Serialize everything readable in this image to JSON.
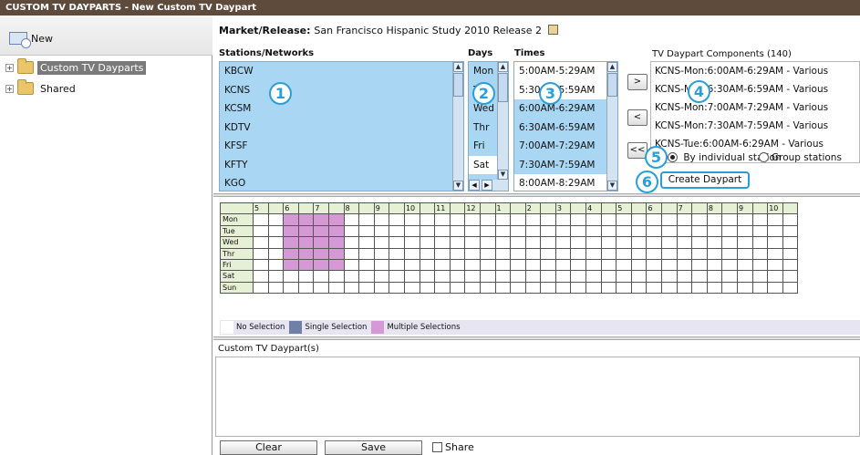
{
  "window": {
    "title": "CUSTOM TV DAYPARTS - New Custom TV Daypart"
  },
  "left_panel": {
    "new_label": "New",
    "tree": [
      {
        "label": "Custom TV Dayparts",
        "selected": true
      },
      {
        "label": "Shared",
        "selected": false
      }
    ]
  },
  "market": {
    "label": "Market/Release:",
    "value": "San Francisco Hispanic Study 2010 Release 2"
  },
  "stations": {
    "header": "Stations/Networks",
    "items": [
      "KBCW",
      "KCNS",
      "KCSM",
      "KDTV",
      "KFSF",
      "KFTY",
      "KGO"
    ]
  },
  "days": {
    "header": "Days",
    "items": [
      "Mon",
      "Tue",
      "Wed",
      "Thr",
      "Fri",
      "Sat"
    ],
    "selected": [
      "Mon",
      "Tue",
      "Wed",
      "Thr",
      "Fri"
    ]
  },
  "times": {
    "header": "Times",
    "items": [
      "5:00AM-5:29AM",
      "5:30AM-5:59AM",
      "6:00AM-6:29AM",
      "6:30AM-6:59AM",
      "7:00AM-7:29AM",
      "7:30AM-7:59AM",
      "8:00AM-8:29AM"
    ],
    "selected": [
      "6:00AM-6:29AM",
      "6:30AM-6:59AM",
      "7:00AM-7:29AM",
      "7:30AM-7:59AM"
    ]
  },
  "transfer_buttons": {
    "add": ">",
    "remove": "<",
    "remove_all": "<<"
  },
  "components": {
    "header": "TV Daypart Components (140)",
    "items": [
      "KCNS-Mon:6:00AM-6:29AM - Various",
      "KCNS-Mon:6:30AM-6:59AM - Various",
      "KCNS-Mon:7:00AM-7:29AM - Various",
      "KCNS-Mon:7:30AM-7:59AM - Various",
      "KCNS-Tue:6:00AM-6:29AM - Various"
    ]
  },
  "options": {
    "by_station": "By individual station",
    "group_stations": "Group stations",
    "selected": "by_station"
  },
  "create_button": "Create Daypart",
  "callouts": [
    "1",
    "2",
    "3",
    "4",
    "5",
    "6"
  ],
  "grid": {
    "hours": [
      "5",
      "",
      "6",
      "",
      "7",
      "",
      "8",
      "",
      "9",
      "",
      "10",
      "",
      "11",
      "",
      "12",
      "",
      "1",
      "",
      "2",
      "",
      "3",
      "",
      "4",
      "",
      "5",
      "",
      "6",
      "",
      "7",
      "",
      "8",
      "",
      "9",
      "",
      "10",
      ""
    ],
    "days": [
      "Mon",
      "Tue",
      "Wed",
      "Thr",
      "Fri",
      "Sat",
      "Sun"
    ],
    "selected_days": [
      "Mon",
      "Tue",
      "Wed",
      "Thr",
      "Fri"
    ],
    "selected_cols": [
      2,
      3,
      4,
      5
    ]
  },
  "legend": {
    "none": "No Selection",
    "single": "Single Selection",
    "multiple": "Multiple Selections"
  },
  "legend_colors": {
    "none": "#ffffff",
    "single": "#6f7fa6",
    "multiple": "#d599d6"
  },
  "custom_list": {
    "header": "Custom TV Daypart(s)"
  },
  "footer": {
    "clear": "Clear",
    "save": "Save",
    "share": "Share"
  },
  "colors": {
    "title_bar": "#5e4b3c",
    "list_selection": "#a9d6f2",
    "callout": "#2a9ed8",
    "grid_pink": "#d599d6"
  }
}
